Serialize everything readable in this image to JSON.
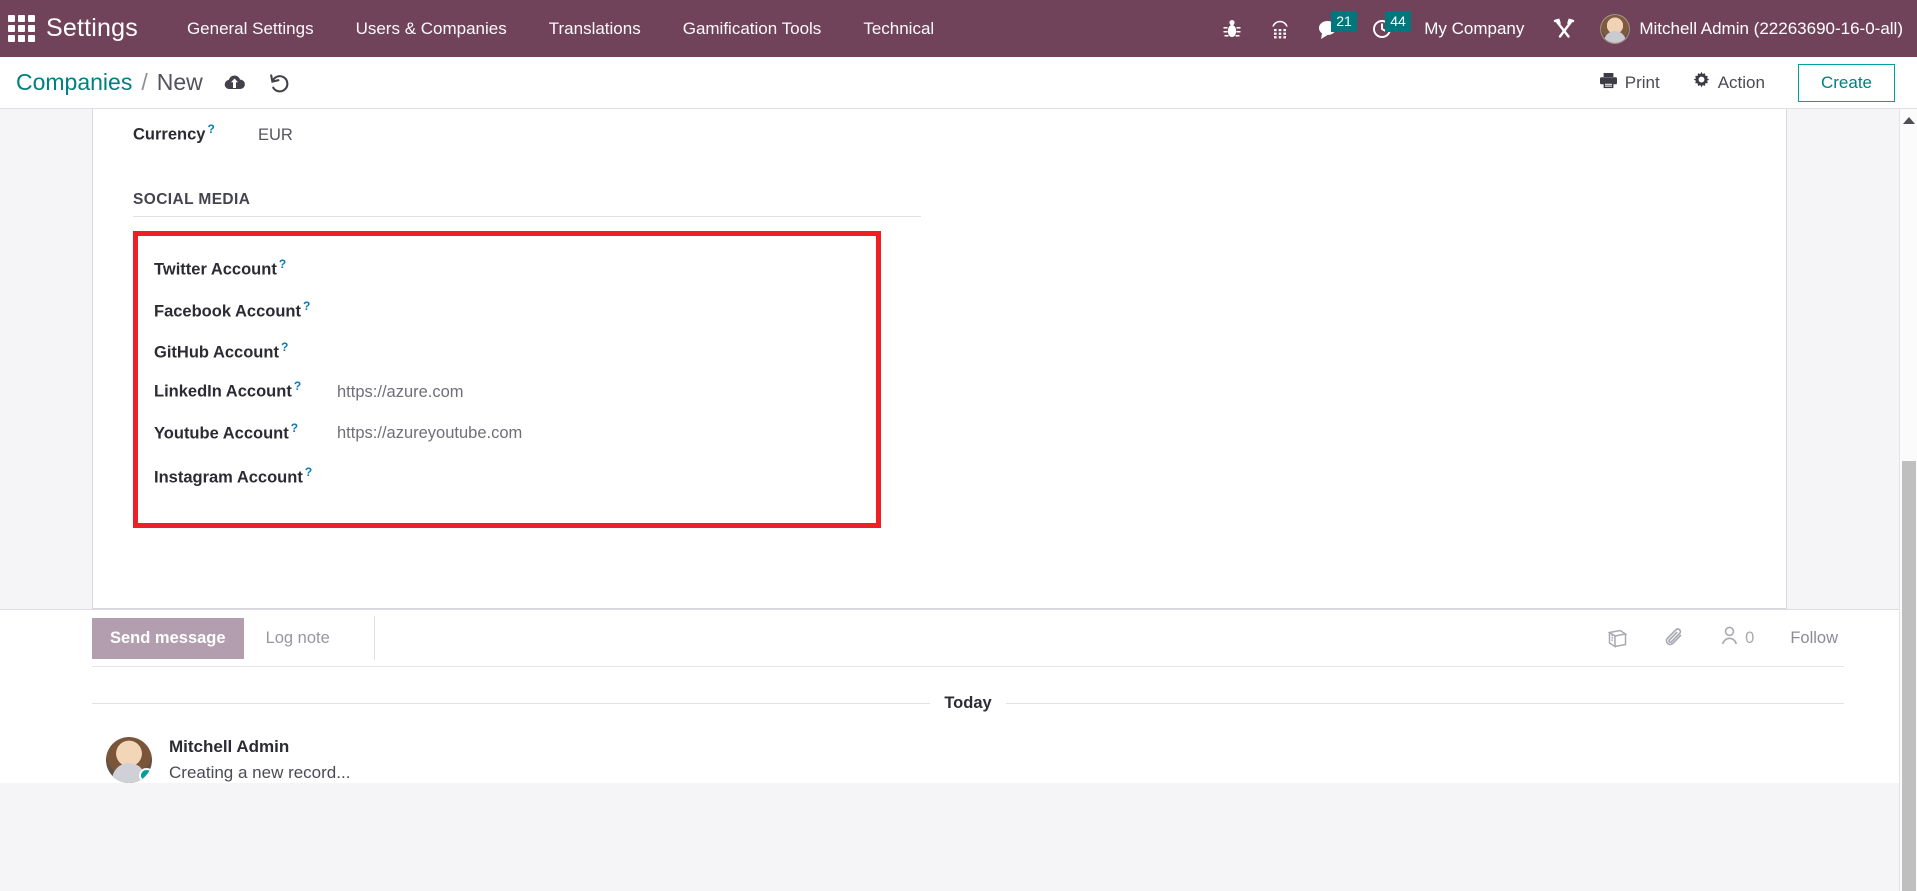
{
  "navbar": {
    "apps_icon": "apps-grid-icon",
    "brand": "Settings",
    "menu": [
      {
        "label": "General Settings"
      },
      {
        "label": "Users & Companies"
      },
      {
        "label": "Translations"
      },
      {
        "label": "Gamification Tools"
      },
      {
        "label": "Technical"
      }
    ],
    "icons": [
      {
        "name": "bug-icon",
        "badge": null
      },
      {
        "name": "phone-keypad-icon",
        "badge": null
      },
      {
        "name": "messages-icon",
        "badge": "21"
      },
      {
        "name": "activities-clock-icon",
        "badge": "44"
      }
    ],
    "company": "My Company",
    "tools_icon": "wrench-screwdriver-icon",
    "user": "Mitchell Admin (22263690-16-0-all)",
    "colors": {
      "background": "#71435b",
      "badge": "#00767d"
    }
  },
  "control_panel": {
    "breadcrumb_root": "Companies",
    "breadcrumb_sep": "/",
    "breadcrumb_current": "New",
    "save_icon": "cloud-upload-icon",
    "discard_icon": "undo-arrow-icon",
    "print_label": "Print",
    "print_icon": "printer-icon",
    "action_label": "Action",
    "action_icon": "gear-icon",
    "create_label": "Create",
    "accent": "#00a09d"
  },
  "form": {
    "currency": {
      "label": "Currency",
      "help": "?",
      "value": "EUR"
    },
    "social_section_title": "SOCIAL MEDIA",
    "highlight_color": "#ef2025",
    "social_fields": [
      {
        "label": "Twitter Account",
        "help": "?",
        "value": ""
      },
      {
        "label": "Facebook Account",
        "help": "?",
        "value": ""
      },
      {
        "label": "GitHub Account",
        "help": "?",
        "value": ""
      },
      {
        "label": "LinkedIn Account",
        "help": "?",
        "value": "https://azure.com"
      },
      {
        "label": "Youtube Account",
        "help": "?",
        "value": "https://azureyoutube.com"
      },
      {
        "label": "Instagram Account",
        "help": "?",
        "value": ""
      }
    ]
  },
  "chatter": {
    "send_message_label": "Send message",
    "log_note_label": "Log note",
    "schedule_activity_icon": "activity-book-icon",
    "attach_file_icon": "paperclip-icon",
    "followers_icon": "person-icon",
    "followers_count": "0",
    "follow_label": "Follow",
    "day_separator": "Today",
    "messages": [
      {
        "author": "Mitchell Admin",
        "body": "Creating a new record..."
      }
    ]
  },
  "scrollbar": {
    "up_arrow_icon": "scroll-up-arrow-icon"
  }
}
